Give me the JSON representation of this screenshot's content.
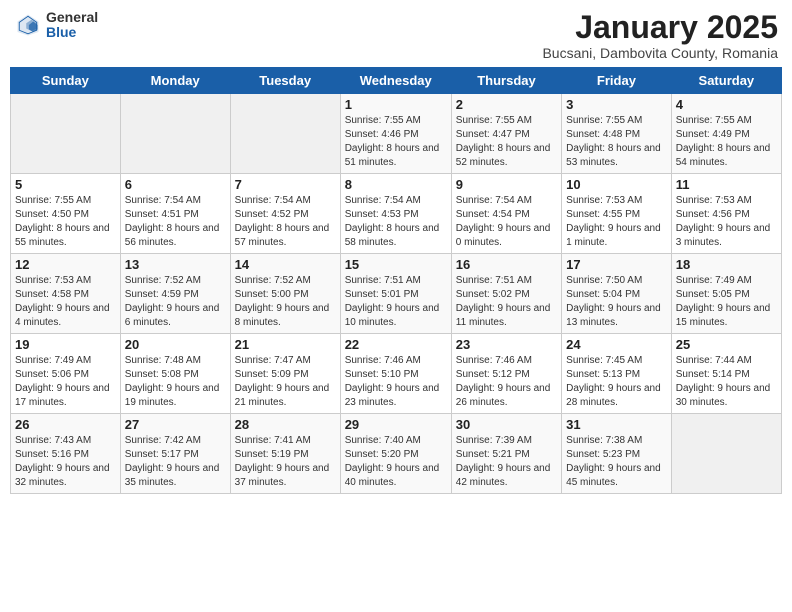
{
  "header": {
    "logo_general": "General",
    "logo_blue": "Blue",
    "title": "January 2025",
    "subtitle": "Bucsani, Dambovita County, Romania"
  },
  "days_of_week": [
    "Sunday",
    "Monday",
    "Tuesday",
    "Wednesday",
    "Thursday",
    "Friday",
    "Saturday"
  ],
  "weeks": [
    [
      {
        "day": "",
        "info": ""
      },
      {
        "day": "",
        "info": ""
      },
      {
        "day": "",
        "info": ""
      },
      {
        "day": "1",
        "info": "Sunrise: 7:55 AM\nSunset: 4:46 PM\nDaylight: 8 hours and 51 minutes."
      },
      {
        "day": "2",
        "info": "Sunrise: 7:55 AM\nSunset: 4:47 PM\nDaylight: 8 hours and 52 minutes."
      },
      {
        "day": "3",
        "info": "Sunrise: 7:55 AM\nSunset: 4:48 PM\nDaylight: 8 hours and 53 minutes."
      },
      {
        "day": "4",
        "info": "Sunrise: 7:55 AM\nSunset: 4:49 PM\nDaylight: 8 hours and 54 minutes."
      }
    ],
    [
      {
        "day": "5",
        "info": "Sunrise: 7:55 AM\nSunset: 4:50 PM\nDaylight: 8 hours and 55 minutes."
      },
      {
        "day": "6",
        "info": "Sunrise: 7:54 AM\nSunset: 4:51 PM\nDaylight: 8 hours and 56 minutes."
      },
      {
        "day": "7",
        "info": "Sunrise: 7:54 AM\nSunset: 4:52 PM\nDaylight: 8 hours and 57 minutes."
      },
      {
        "day": "8",
        "info": "Sunrise: 7:54 AM\nSunset: 4:53 PM\nDaylight: 8 hours and 58 minutes."
      },
      {
        "day": "9",
        "info": "Sunrise: 7:54 AM\nSunset: 4:54 PM\nDaylight: 9 hours and 0 minutes."
      },
      {
        "day": "10",
        "info": "Sunrise: 7:53 AM\nSunset: 4:55 PM\nDaylight: 9 hours and 1 minute."
      },
      {
        "day": "11",
        "info": "Sunrise: 7:53 AM\nSunset: 4:56 PM\nDaylight: 9 hours and 3 minutes."
      }
    ],
    [
      {
        "day": "12",
        "info": "Sunrise: 7:53 AM\nSunset: 4:58 PM\nDaylight: 9 hours and 4 minutes."
      },
      {
        "day": "13",
        "info": "Sunrise: 7:52 AM\nSunset: 4:59 PM\nDaylight: 9 hours and 6 minutes."
      },
      {
        "day": "14",
        "info": "Sunrise: 7:52 AM\nSunset: 5:00 PM\nDaylight: 9 hours and 8 minutes."
      },
      {
        "day": "15",
        "info": "Sunrise: 7:51 AM\nSunset: 5:01 PM\nDaylight: 9 hours and 10 minutes."
      },
      {
        "day": "16",
        "info": "Sunrise: 7:51 AM\nSunset: 5:02 PM\nDaylight: 9 hours and 11 minutes."
      },
      {
        "day": "17",
        "info": "Sunrise: 7:50 AM\nSunset: 5:04 PM\nDaylight: 9 hours and 13 minutes."
      },
      {
        "day": "18",
        "info": "Sunrise: 7:49 AM\nSunset: 5:05 PM\nDaylight: 9 hours and 15 minutes."
      }
    ],
    [
      {
        "day": "19",
        "info": "Sunrise: 7:49 AM\nSunset: 5:06 PM\nDaylight: 9 hours and 17 minutes."
      },
      {
        "day": "20",
        "info": "Sunrise: 7:48 AM\nSunset: 5:08 PM\nDaylight: 9 hours and 19 minutes."
      },
      {
        "day": "21",
        "info": "Sunrise: 7:47 AM\nSunset: 5:09 PM\nDaylight: 9 hours and 21 minutes."
      },
      {
        "day": "22",
        "info": "Sunrise: 7:46 AM\nSunset: 5:10 PM\nDaylight: 9 hours and 23 minutes."
      },
      {
        "day": "23",
        "info": "Sunrise: 7:46 AM\nSunset: 5:12 PM\nDaylight: 9 hours and 26 minutes."
      },
      {
        "day": "24",
        "info": "Sunrise: 7:45 AM\nSunset: 5:13 PM\nDaylight: 9 hours and 28 minutes."
      },
      {
        "day": "25",
        "info": "Sunrise: 7:44 AM\nSunset: 5:14 PM\nDaylight: 9 hours and 30 minutes."
      }
    ],
    [
      {
        "day": "26",
        "info": "Sunrise: 7:43 AM\nSunset: 5:16 PM\nDaylight: 9 hours and 32 minutes."
      },
      {
        "day": "27",
        "info": "Sunrise: 7:42 AM\nSunset: 5:17 PM\nDaylight: 9 hours and 35 minutes."
      },
      {
        "day": "28",
        "info": "Sunrise: 7:41 AM\nSunset: 5:19 PM\nDaylight: 9 hours and 37 minutes."
      },
      {
        "day": "29",
        "info": "Sunrise: 7:40 AM\nSunset: 5:20 PM\nDaylight: 9 hours and 40 minutes."
      },
      {
        "day": "30",
        "info": "Sunrise: 7:39 AM\nSunset: 5:21 PM\nDaylight: 9 hours and 42 minutes."
      },
      {
        "day": "31",
        "info": "Sunrise: 7:38 AM\nSunset: 5:23 PM\nDaylight: 9 hours and 45 minutes."
      },
      {
        "day": "",
        "info": ""
      }
    ]
  ]
}
